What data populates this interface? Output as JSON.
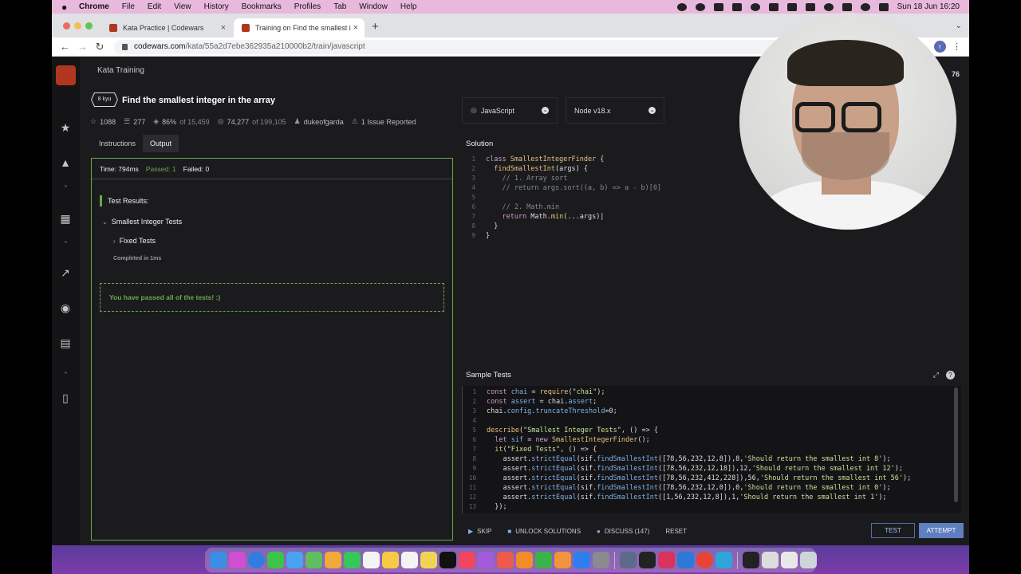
{
  "menubar": {
    "app": "Chrome",
    "items": [
      "File",
      "Edit",
      "View",
      "History",
      "Bookmarks",
      "Profiles",
      "Tab",
      "Window",
      "Help"
    ],
    "clock": "Sun 18 Jun  16:20"
  },
  "browser": {
    "tabs": [
      {
        "title": "Kata Practice | Codewars"
      },
      {
        "title": "Training on Find the smallest in"
      }
    ],
    "url_host": "codewars.com",
    "url_path": "/kata/55a2d7ebe362935a210000b2/train/javascript",
    "profile_initial": "r"
  },
  "page": {
    "breadcrumb": "Kata Training",
    "rank_partial": "76",
    "kyu": "8 kyu",
    "title": "Find the smallest integer in the array",
    "stats": {
      "stars": "1088",
      "collections": "277",
      "satisfaction": "86%",
      "satisfaction_of": "of 15,459",
      "completions": "74,277",
      "completions_of": "of 199,105",
      "author": "dukeofgarda",
      "issues": "1 Issue Reported"
    },
    "tabs": {
      "instructions": "Instructions",
      "output": "Output"
    },
    "run": {
      "time": "Time: 794ms",
      "passed": "Passed: 1",
      "failed": "Failed: 0"
    },
    "results_label": "Test Results:",
    "group": "Smallest Integer Tests",
    "subgroup": "Fixed Tests",
    "completed": "Completed in 1ms",
    "passed_msg": "You have passed all of the tests! :)"
  },
  "editor": {
    "language": "JavaScript",
    "runtime": "Node v18.x",
    "solution_label": "Solution",
    "sample_label": "Sample Tests"
  },
  "footer": {
    "skip": "SKIP",
    "unlock": "UNLOCK SOLUTIONS",
    "discuss": "DISCUSS (147)",
    "reset": "RESET",
    "test": "TEST",
    "attempt": "ATTEMPT"
  },
  "colors": {
    "accent_green": "#6aa84f",
    "brand_red": "#b1361e",
    "attempt_blue": "#5e7fc0"
  }
}
